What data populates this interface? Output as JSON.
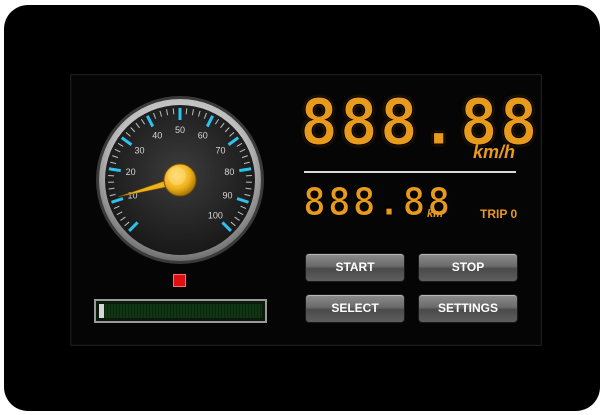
{
  "speedometer": {
    "scale_min": 0,
    "scale_max": 100,
    "tick_labels": [
      "10",
      "20",
      "30",
      "40",
      "50",
      "60",
      "70",
      "80",
      "90",
      "100"
    ],
    "needle_value": 11,
    "colors": {
      "ticks": "#2ec2ee",
      "needle": "#f0b21a",
      "face": "#2a2a2a",
      "bezel": "#c9c9c9"
    }
  },
  "speed_display": {
    "digits": "888.88",
    "unit": "km/h",
    "color": "#e89a1d"
  },
  "trip_display": {
    "digits": "888.88",
    "unit": "km",
    "label": "TRIP 0"
  },
  "indicator": {
    "color": "#e01010"
  },
  "progress_bar": {
    "value": 0.03
  },
  "buttons": {
    "start": "START",
    "stop": "STOP",
    "select": "SELECT",
    "settings": "SETTINGS"
  }
}
